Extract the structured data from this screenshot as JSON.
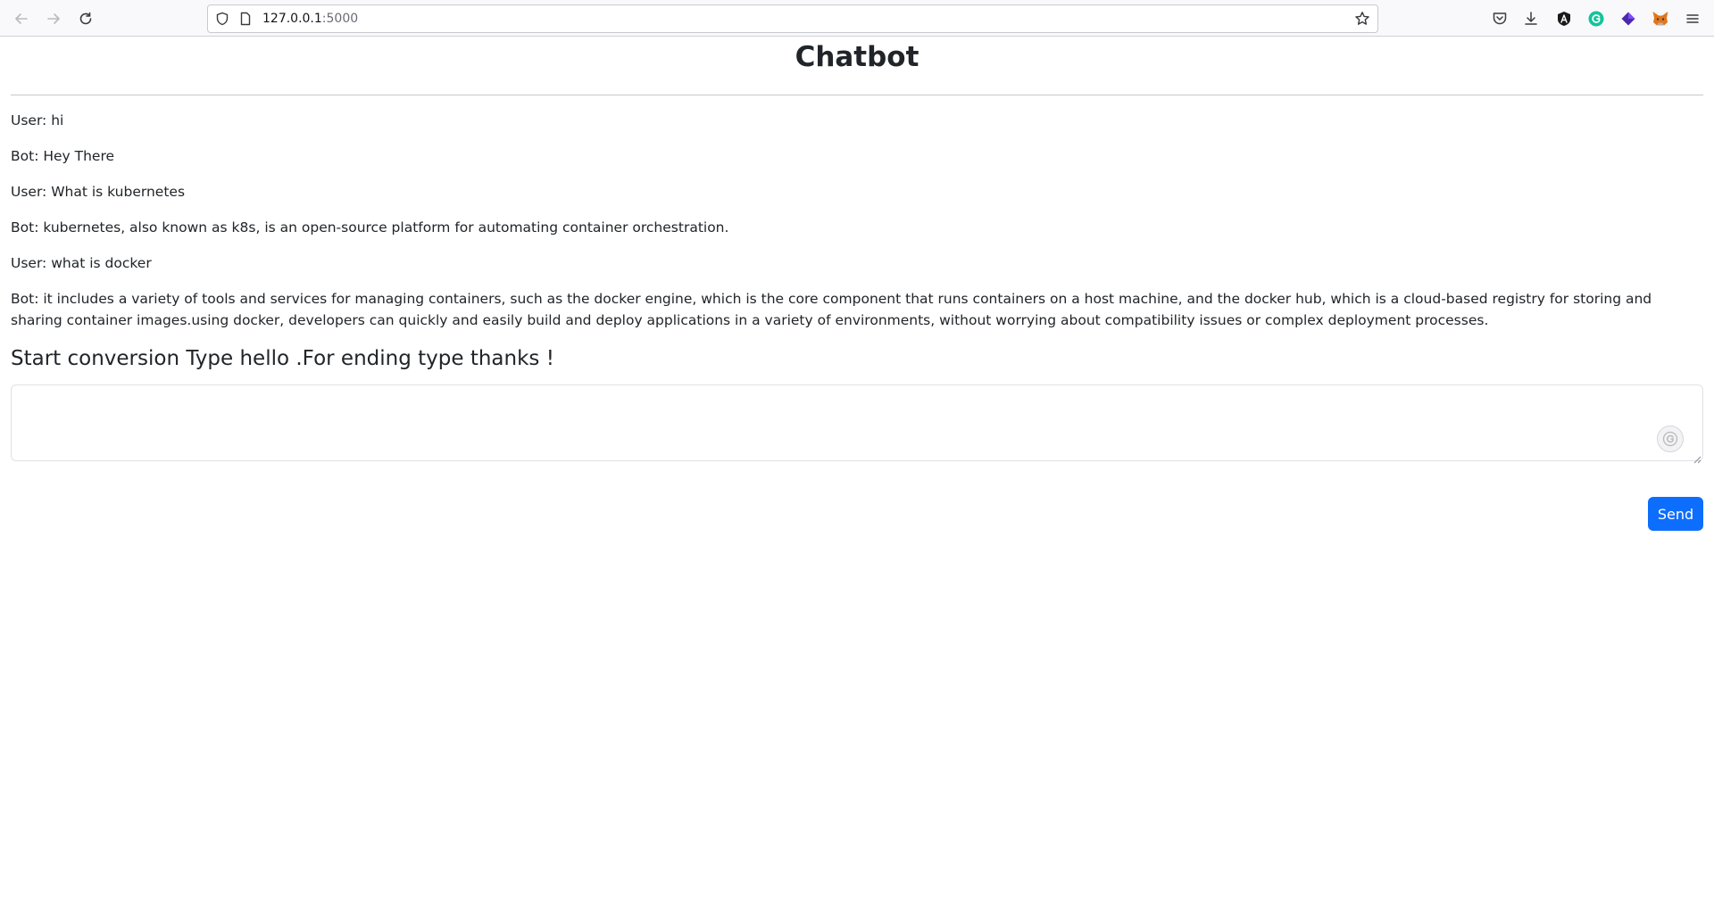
{
  "browser": {
    "url_host": "127.0.0.1",
    "url_port": ":5000",
    "icons": [
      "back-icon",
      "forward-icon",
      "reload-icon",
      "shield-icon",
      "page-icon",
      "bookmark-star-icon",
      "pocket-icon",
      "download-icon",
      "extension-a-icon",
      "grammarly-icon",
      "extension-purple-icon",
      "metamask-icon",
      "menu-icon"
    ]
  },
  "page": {
    "title": "Chatbot",
    "messages": [
      "User: hi",
      "Bot: Hey There",
      "User: What is kubernetes",
      "Bot: kubernetes, also known as k8s, is an open-source platform for automating container orchestration.",
      "User: what is docker",
      "Bot: it includes a variety of tools and services for managing containers, such as the docker engine, which is the core component that runs containers on a host machine, and the docker hub, which is a cloud-based registry for storing and sharing container images.using docker, developers can quickly and easily build and deploy applications in a variety of environments, without worrying about compatibility issues or complex deployment processes."
    ],
    "prompt_label": "Start conversion Type hello .For ending type thanks !",
    "input_value": "",
    "send_label": "Send",
    "accent_color": "#0d6efd"
  }
}
